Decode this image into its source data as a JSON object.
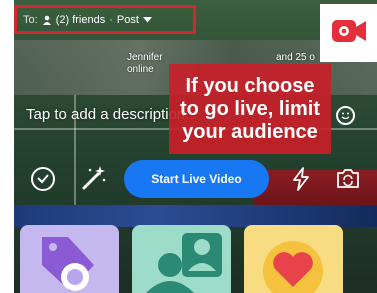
{
  "audience": {
    "to_label": "To:",
    "friends": "(2) friends",
    "separator": "·",
    "post": "Post"
  },
  "tags": {
    "name": "Jennifer",
    "online": "online",
    "others": "and 25 o"
  },
  "callout": {
    "line1": "If you choose",
    "line2": "to go live, limit",
    "line3": "your audience"
  },
  "composer": {
    "description_placeholder": "Tap to add a description..."
  },
  "actions": {
    "start_live": "Start Live Video"
  },
  "colors": {
    "accent_blue": "#1877f2",
    "highlight_red": "#d4262f",
    "callout_red": "#c82028"
  },
  "icons": [
    "person-icon",
    "caret-down-icon",
    "live-video-icon",
    "emoji-icon",
    "check-circle-icon",
    "magic-wand-icon",
    "flash-icon",
    "camera-flip-icon",
    "tag-icon",
    "people-icon",
    "heart-icon"
  ]
}
